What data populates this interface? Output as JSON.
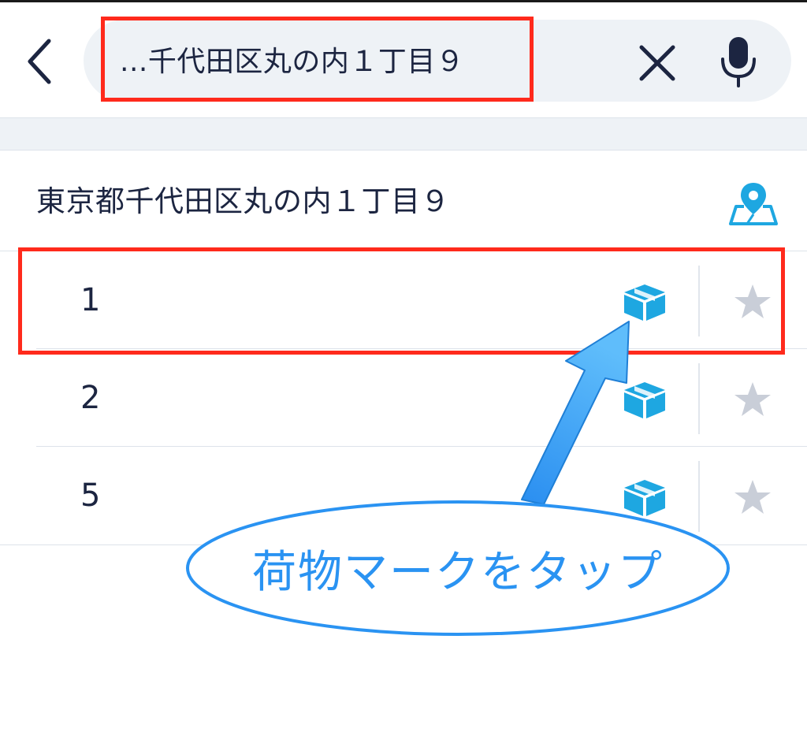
{
  "search": {
    "query": "...千代田区丸の内１丁目９"
  },
  "address": {
    "title": "東京都千代田区丸の内１丁目９"
  },
  "results": [
    {
      "number": "1"
    },
    {
      "number": "2"
    },
    {
      "number": "5"
    }
  ],
  "annotation": {
    "callout": "荷物マークをタップ"
  },
  "colors": {
    "text": "#1c2541",
    "accent": "#1ea7e1",
    "highlight": "#ff2a1c",
    "callout": "#2a93f2",
    "star": "#c9ced8"
  },
  "icons": {
    "back": "chevron-left-icon",
    "clear": "close-icon",
    "mic": "microphone-icon",
    "map": "map-pin-icon",
    "package": "package-icon",
    "favorite": "star-icon"
  }
}
